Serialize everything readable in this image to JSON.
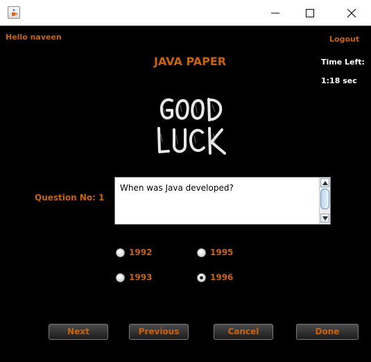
{
  "window": {
    "icon": "java-cup-icon",
    "controls": [
      "minimize-icon",
      "maximize-icon",
      "close-icon"
    ]
  },
  "header": {
    "greeting": "Hello naveen",
    "logout": "Logout",
    "title": "JAVA PAPER"
  },
  "timer": {
    "label": "Time Left:",
    "value": "1:18 sec"
  },
  "banner": {
    "alt_text": "GOOD LUCK"
  },
  "question": {
    "label": "Question No: 1",
    "text": "When was Java developed?"
  },
  "options": [
    {
      "label": "1992",
      "selected": false
    },
    {
      "label": "1995",
      "selected": false
    },
    {
      "label": "1993",
      "selected": false
    },
    {
      "label": "1996",
      "selected": true
    }
  ],
  "buttons": {
    "next": "Next",
    "previous": "Previous",
    "cancel": "Cancel",
    "done": "Done"
  },
  "colors": {
    "accent": "#c8630f",
    "background": "#000000",
    "text_light": "#ffffff"
  }
}
